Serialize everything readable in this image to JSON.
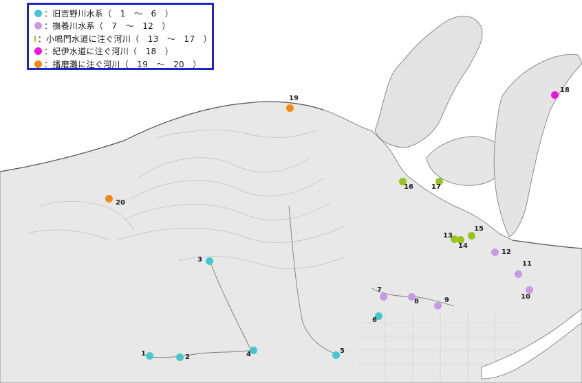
{
  "legend": {
    "items": [
      {
        "label": "：旧吉野川水系（　1　～　6　）",
        "color": "#45c7cf"
      },
      {
        "label": "：撫養川水系（　7　～　12　）",
        "color": "#c79ae6"
      },
      {
        "label": "：小鳴門水道に注ぐ河川（　13　～　17　）",
        "color": "#98c41c"
      },
      {
        "label": "：紀伊水道に注ぐ河川（　18　）",
        "color": "#ee16dc"
      },
      {
        "label": "：播磨灘に注ぐ河川（　19　～　20　）",
        "color": "#f08a12"
      }
    ]
  },
  "sites": [
    {
      "id": "1",
      "group": 0
    },
    {
      "id": "2",
      "group": 0
    },
    {
      "id": "3",
      "group": 0
    },
    {
      "id": "4",
      "group": 0
    },
    {
      "id": "5",
      "group": 0
    },
    {
      "id": "6",
      "group": 0
    },
    {
      "id": "7",
      "group": 1
    },
    {
      "id": "8",
      "group": 1
    },
    {
      "id": "9",
      "group": 1
    },
    {
      "id": "10",
      "group": 1
    },
    {
      "id": "11",
      "group": 1
    },
    {
      "id": "12",
      "group": 1
    },
    {
      "id": "13",
      "group": 2
    },
    {
      "id": "14",
      "group": 2
    },
    {
      "id": "15",
      "group": 2
    },
    {
      "id": "16",
      "group": 2
    },
    {
      "id": "17",
      "group": 2
    },
    {
      "id": "18",
      "group": 3
    },
    {
      "id": "19",
      "group": 4
    },
    {
      "id": "20",
      "group": 4
    }
  ]
}
